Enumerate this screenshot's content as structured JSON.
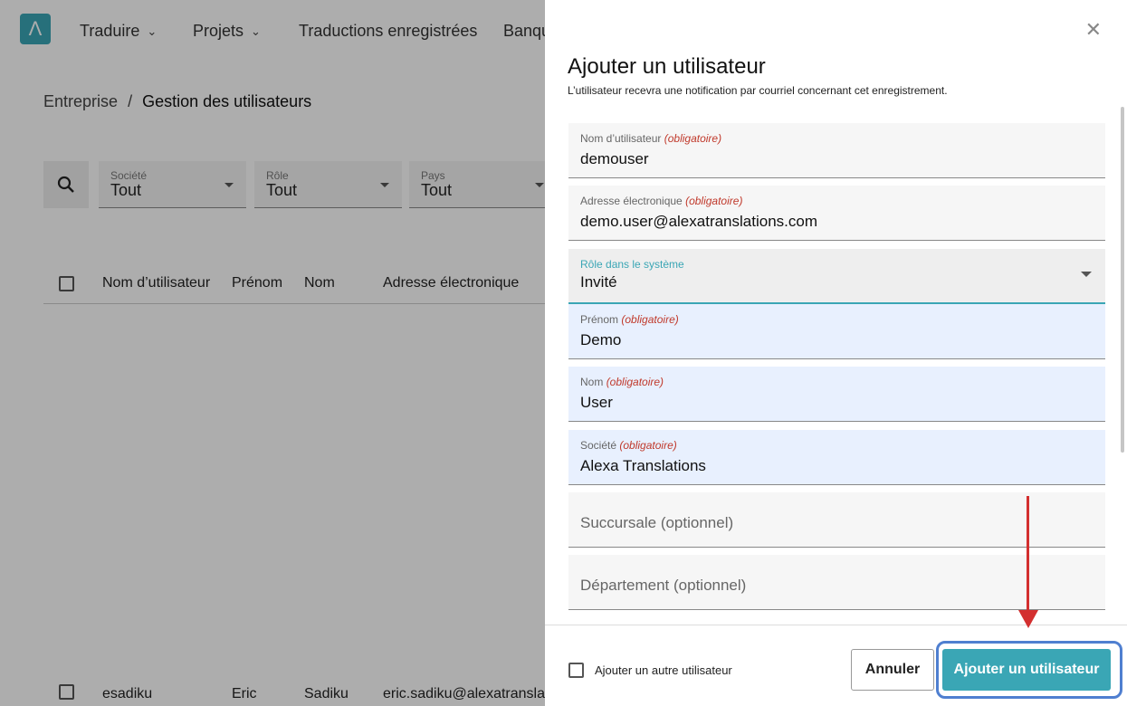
{
  "nav": {
    "items": [
      {
        "label": "Traduire",
        "has_dropdown": true
      },
      {
        "label": "Projets",
        "has_dropdown": true
      },
      {
        "label": "Traductions enregistrées",
        "has_dropdown": false
      },
      {
        "label": "Banqu",
        "has_dropdown": false
      }
    ]
  },
  "breadcrumb": {
    "parent": "Entreprise",
    "separator": "/",
    "current": "Gestion des utilisateurs"
  },
  "filters": [
    {
      "label": "Société",
      "value": "Tout"
    },
    {
      "label": "Rôle",
      "value": "Tout"
    },
    {
      "label": "Pays",
      "value": "Tout"
    }
  ],
  "table": {
    "columns": [
      "Nom d’utilisateur",
      "Prénom",
      "Nom",
      "Adresse électronique"
    ],
    "rows": [
      {
        "username": "esadiku",
        "first_name": "Eric",
        "last_name": "Sadiku",
        "email": "eric.sadiku@alexatranslati"
      }
    ]
  },
  "drawer": {
    "title": "Ajouter un utilisateur",
    "subtitle": "L’utilisateur recevra une notification par courriel concernant cet enregistrement.",
    "required_marker": "(obligatoire)",
    "fields": {
      "username": {
        "label": "Nom d’utilisateur",
        "value": "demouser"
      },
      "email": {
        "label": "Adresse électronique",
        "value": "demo.user@alexatranslations.com"
      },
      "role": {
        "label": "Rôle dans le système",
        "value": "Invité"
      },
      "first_name": {
        "label": "Prénom",
        "value": "Demo"
      },
      "last_name": {
        "label": "Nom",
        "value": "User"
      },
      "company": {
        "label": "Société",
        "value": "Alexa Translations"
      },
      "branch": {
        "placeholder": "Succursale (optionnel)"
      },
      "department": {
        "placeholder": "Département (optionnel)"
      }
    },
    "footer": {
      "add_another_label": "Ajouter un autre utilisateur",
      "cancel_label": "Annuler",
      "submit_label": "Ajouter un utilisateur"
    }
  },
  "colors": {
    "accent": "#3aa6b5",
    "required": "#c0392b",
    "annotation_arrow": "#d32f2f",
    "annotation_ring": "#4f7fd0"
  }
}
